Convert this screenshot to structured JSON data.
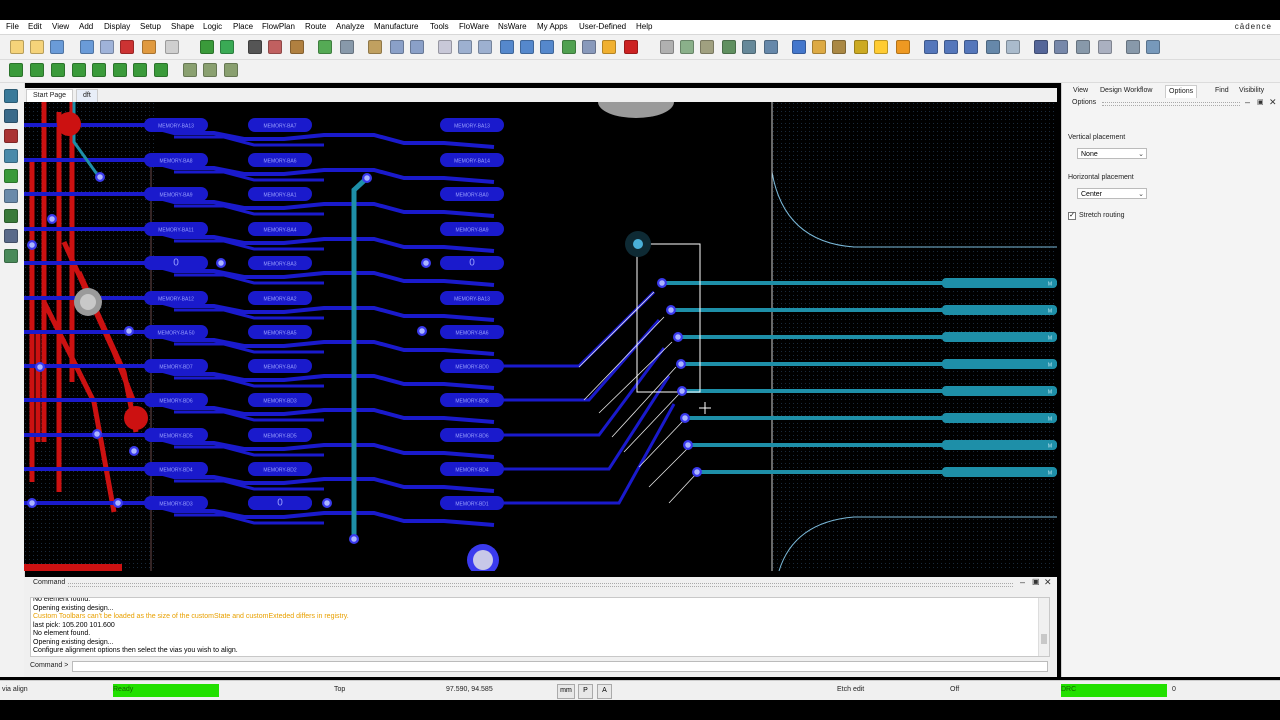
{
  "window": {
    "brand": "cādence"
  },
  "menu": [
    "File",
    "Edit",
    "View",
    "Add",
    "Display",
    "Setup",
    "Shape",
    "Logic",
    "Place",
    "FlowPlan",
    "Route",
    "Analyze",
    "Manufacture",
    "Tools",
    "FloWare",
    "NsWare",
    "My Apps",
    "User-Defined",
    "Help"
  ],
  "doc_tabs": [
    "Start Page",
    "dft"
  ],
  "canvas": {
    "left_labels": [
      "MEMORY-BA13",
      "MEMORY-BA8",
      "MEMORY-BA9",
      "MEMORY-BA11",
      "0",
      "MEMORY-BA12",
      "MEMORY-BA 50",
      "MEMORY-BD7",
      "MEMORY-BD6",
      "MEMORY-BD5",
      "MEMORY-BD4",
      "MEMORY-BD3"
    ],
    "mid_labels": [
      "MEMORY-BA7",
      "MEMORY-BA6",
      "MEMORY-BA1",
      "MEMORY-BA4",
      "MEMORY-BA3",
      "MEMORY-BA2",
      "MEMORY-BA5",
      "MEMORY-BA0",
      "MEMORY-BD3",
      "MEMORY-BD5",
      "MEMORY-BD2",
      "MEMORY-BD1",
      "0"
    ],
    "right_labels": [
      "MEMORY-BA13",
      "MEMORY-BA14",
      "MEMORY-BA0",
      "MEMORY-BA9",
      "0",
      "MEMORY-BA13",
      "MEMORY-BA6",
      "MEMORY-BD0",
      "MEMORY-BD6",
      "MEMORY-BD6",
      "MEMORY-BD4",
      "MEMORY-BD1"
    ],
    "edge_labels": [
      "M",
      "M",
      "M",
      "M",
      "M",
      "M",
      "M",
      "M"
    ]
  },
  "command": {
    "title": "Command",
    "log": [
      {
        "text": "No element found.",
        "warn": false
      },
      {
        "text": "Opening existing design...",
        "warn": false
      },
      {
        "text": "Custom Toolbars can't be loaded as the size of the customState and customExteded differs in registry.",
        "warn": true
      },
      {
        "text": "last pick:  105.200 101.600",
        "warn": false
      },
      {
        "text": "No element found.",
        "warn": false
      },
      {
        "text": "Opening existing design...",
        "warn": false
      },
      {
        "text": "Configure alignment options then select the vias you wish to align.",
        "warn": false
      }
    ],
    "prompt": "Command >",
    "input_value": ""
  },
  "right_panel": {
    "tabs": [
      "View",
      "Design Workflow",
      "Options",
      "Find",
      "Visibility"
    ],
    "active_tab": "Options",
    "section_title": "Options",
    "vertical_label": "Vertical placement",
    "vertical_value": "None",
    "horizontal_label": "Horizontal placement",
    "horizontal_value": "Center",
    "stretch_label": "Stretch routing",
    "stretch_checked": true
  },
  "status": {
    "command": "via align",
    "state": "Ready",
    "layer": "Top",
    "coords": "97.590, 94.585",
    "units": "mm",
    "btn_p": "P",
    "btn_a": "A",
    "mode": "Etch edit",
    "off": "Off",
    "drc": "DRC",
    "drc_count": "0"
  },
  "colors": {
    "ready": "#22e000",
    "trace_blue": "#1a1acc",
    "trace_cyan": "#1e8fa8",
    "trace_red": "#cc1111"
  }
}
